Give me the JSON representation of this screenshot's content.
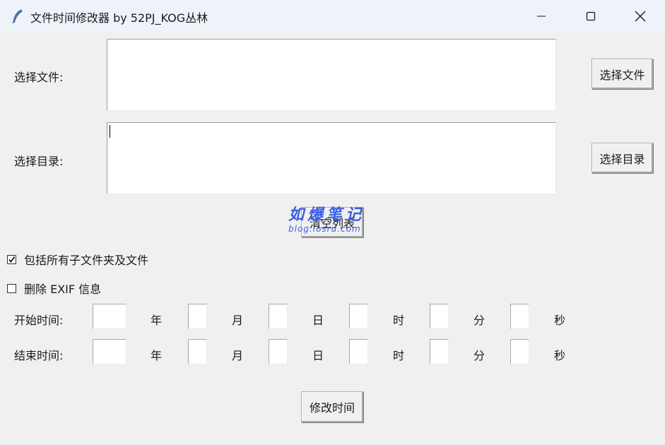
{
  "window": {
    "title": "文件时间修改器 by 52PJ_KOG丛林",
    "icon": "feather-icon",
    "controls": [
      "minimize-icon",
      "maximize-icon",
      "close-icon"
    ]
  },
  "file_section": {
    "label": "选择文件:",
    "value": "",
    "button": "选择文件"
  },
  "dir_section": {
    "label": "选择目录:",
    "value": "",
    "button": "选择目录"
  },
  "clear_button": "清空列表",
  "options": {
    "include_subfolders": {
      "label": "包括所有子文件夹及文件",
      "checked": true
    },
    "remove_exif": {
      "label": "删除 EXIF 信息",
      "checked": false
    }
  },
  "time": {
    "start_label": "开始时间:",
    "end_label": "结束时间:",
    "units": [
      "年",
      "月",
      "日",
      "时",
      "分",
      "秒"
    ],
    "start_values": [
      "",
      "",
      "",
      "",
      "",
      ""
    ],
    "end_values": [
      "",
      "",
      "",
      "",
      "",
      ""
    ]
  },
  "modify_button": "修改时间",
  "watermark": {
    "main": "如爆笔记",
    "sub": "blog.iosru.com"
  }
}
